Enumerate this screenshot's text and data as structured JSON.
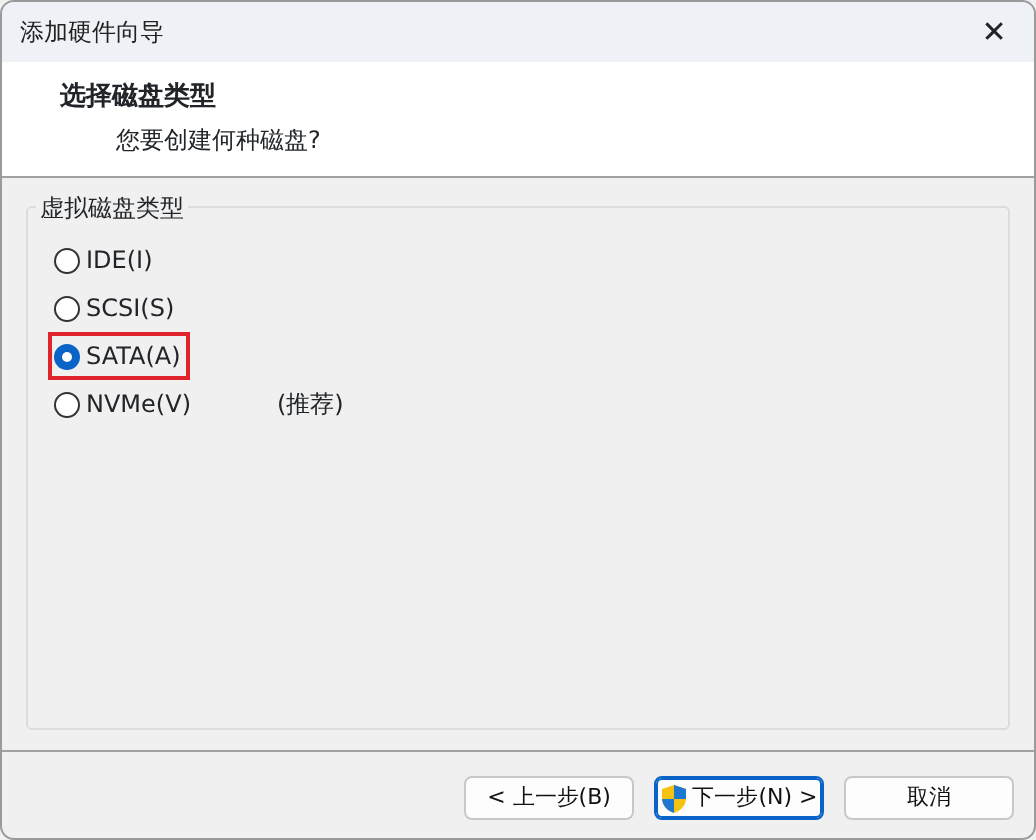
{
  "window": {
    "title": "添加硬件向导",
    "close": "✕"
  },
  "header": {
    "title": "选择磁盘类型",
    "subtitle": "您要创建何种磁盘?"
  },
  "group": {
    "title": "虚拟磁盘类型",
    "options": [
      {
        "label": "IDE(I)",
        "selected": false,
        "highlighted": false
      },
      {
        "label": "SCSI(S)",
        "selected": false,
        "highlighted": false
      },
      {
        "label": "SATA(A)",
        "selected": true,
        "highlighted": true
      },
      {
        "label": "NVMe(V)",
        "selected": false,
        "highlighted": false,
        "note": "(推荐)"
      }
    ]
  },
  "buttons": [
    {
      "label": "< 上一步(B)",
      "shield": false,
      "focused": false
    },
    {
      "label": "下一步(N) >",
      "shield": true,
      "focused": true
    },
    {
      "label": "取消",
      "shield": false,
      "focused": false
    }
  ]
}
